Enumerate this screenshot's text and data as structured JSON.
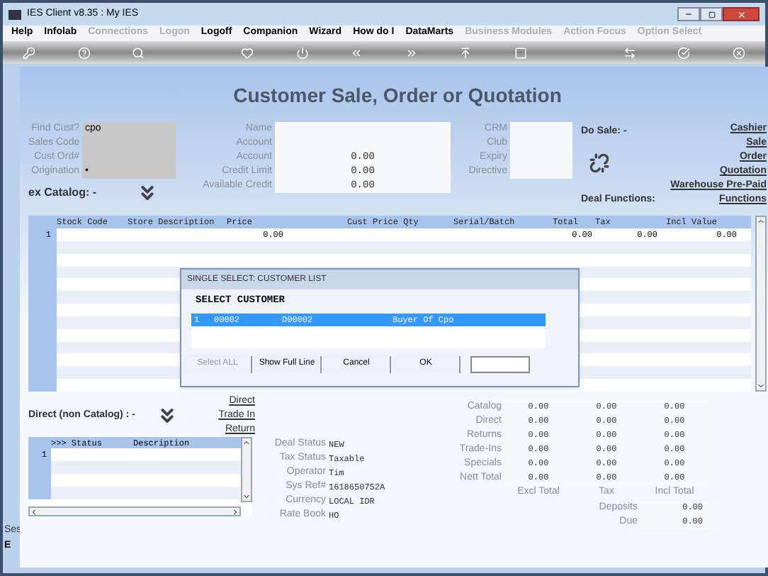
{
  "window": {
    "title": "IES Client v8.35 : My IES"
  },
  "menu": [
    {
      "label": "Help",
      "disabled": false
    },
    {
      "label": "Infolab",
      "disabled": false
    },
    {
      "label": "Connections",
      "disabled": true
    },
    {
      "label": "Logon",
      "disabled": true
    },
    {
      "label": "Logoff",
      "disabled": false
    },
    {
      "label": "Companion",
      "disabled": false
    },
    {
      "label": "Wizard",
      "disabled": false
    },
    {
      "label": "How do I",
      "disabled": false
    },
    {
      "label": "DataMarts",
      "disabled": false
    },
    {
      "label": "Business Modules",
      "disabled": true
    },
    {
      "label": "Action Focus",
      "disabled": true
    },
    {
      "label": "Option Select",
      "disabled": true
    }
  ],
  "page_title": "Customer Sale, Order or Quotation",
  "find_fields": [
    {
      "label": "Find Cust?",
      "value": "cpo"
    },
    {
      "label": "Sales Code"
    },
    {
      "label": "Cust Ord#"
    },
    {
      "label": "Origination",
      "value": "•"
    }
  ],
  "customer_fields": [
    {
      "label": "Name"
    },
    {
      "label": "Account"
    },
    {
      "label": "Account",
      "value": "0.00"
    },
    {
      "label": "Credit Limit",
      "value": "0.00"
    },
    {
      "label": "Available Credit",
      "value": "0.00"
    }
  ],
  "crm_fields": [
    {
      "label": "CRM"
    },
    {
      "label": "Club"
    },
    {
      "label": "Expiry"
    },
    {
      "label": "Directive"
    }
  ],
  "do_sale": {
    "label": "Do Sale: -",
    "links": [
      "Cashier",
      "Sale",
      "Order",
      "Quotation",
      "Warehouse Pre-Paid",
      "Functions"
    ]
  },
  "deal_functions": {
    "label": "Deal Functions:"
  },
  "catalog": {
    "label": "ex Catalog: -",
    "columns": [
      "Stock Code",
      "Store Description",
      "Price",
      "Cust Price Qty",
      "Serial/Batch",
      "Total",
      "Tax",
      "Incl Value"
    ],
    "rows": [
      {
        "number": "1",
        "price": "0.00",
        "total": "0.00",
        "tax": "0.00",
        "incl": "0.00"
      }
    ]
  },
  "dialog": {
    "title": "SINGLE SELECT: CUSTOMER LIST",
    "heading": "SELECT CUSTOMER",
    "rows": [
      {
        "cells": [
          "1",
          "00002",
          "D00002",
          "Buyer Of Cpo"
        ],
        "selected": true
      }
    ],
    "buttons": [
      {
        "label": "Select ALL",
        "disabled": true
      },
      {
        "label": "Show Full Line",
        "disabled": false
      },
      {
        "label": "Cancel",
        "disabled": false
      },
      {
        "label": "OK",
        "disabled": false
      }
    ]
  },
  "direct": {
    "label": "Direct (non Catalog) : -",
    "links": [
      "Direct",
      "Trade In",
      "Return"
    ]
  },
  "status_grid": {
    "columns": [
      ">>> Status",
      "Description"
    ],
    "rows": [
      {
        "number": "1"
      }
    ]
  },
  "side_texts": [
    "Ses",
    "E"
  ],
  "deal_info": [
    {
      "label": "Deal Status",
      "value": "NEW"
    },
    {
      "label": "Tax Status",
      "value": "Taxable"
    },
    {
      "label": "Operator",
      "value": "Tim"
    },
    {
      "label": "Sys Ref#",
      "value": "1618650752A"
    },
    {
      "label": "Currency",
      "value": "LOCAL IDR"
    },
    {
      "label": "Rate Book",
      "value": "HO"
    }
  ],
  "totals": {
    "rows": [
      {
        "label": "Catalog",
        "values": [
          "0.00",
          "0.00",
          "0.00"
        ]
      },
      {
        "label": "Direct",
        "values": [
          "0.00",
          "0.00",
          "0.00"
        ]
      },
      {
        "label": "Returns",
        "values": [
          "0.00",
          "0.00",
          "0.00"
        ]
      },
      {
        "label": "Trade-Ins",
        "values": [
          "0.00",
          "0.00",
          "0.00"
        ]
      },
      {
        "label": "Specials",
        "values": [
          "0.00",
          "0.00",
          "0.00"
        ]
      },
      {
        "label": "Nett Total",
        "values": [
          "0.00",
          "0.00",
          "0.00"
        ]
      }
    ],
    "footers": [
      "Excl Total",
      "Tax",
      "Incl Total"
    ],
    "extra": [
      {
        "label": "Deposits",
        "value": "0.00"
      },
      {
        "label": "Due",
        "value": "0.00"
      }
    ]
  }
}
